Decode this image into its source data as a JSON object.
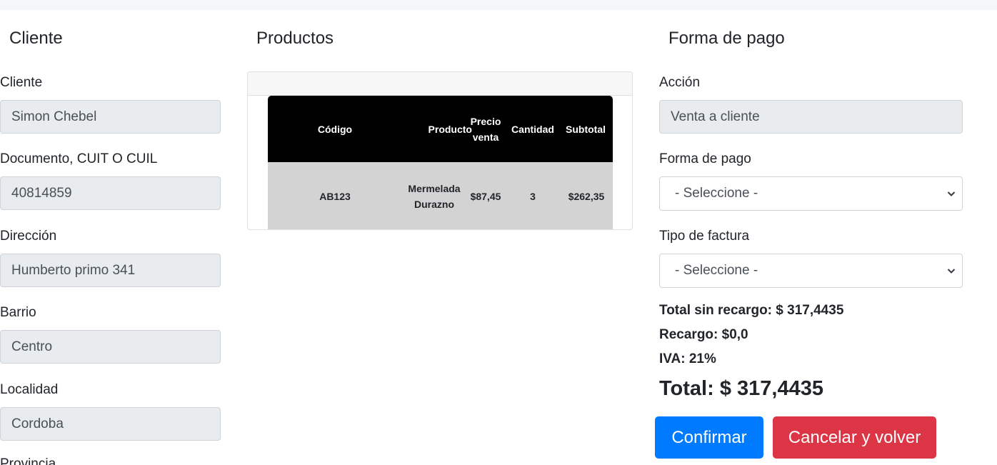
{
  "cliente": {
    "title": "Cliente",
    "fields": [
      {
        "label": "Cliente",
        "value": "Simon Chebel"
      },
      {
        "label": "Documento, CUIT O CUIL",
        "value": "40814859"
      },
      {
        "label": "Dirección",
        "value": "Humberto primo 341"
      },
      {
        "label": "Barrio",
        "value": "Centro"
      },
      {
        "label": "Localidad",
        "value": "Cordoba"
      }
    ],
    "partial_label": "Provincia"
  },
  "productos": {
    "title": "Productos",
    "columns": [
      "Código",
      "Producto",
      "Precio venta",
      "Cantidad",
      "Subtotal"
    ],
    "rows": [
      {
        "codigo": "AB123",
        "producto": "Mermelada Durazno",
        "precio": "$87,45",
        "cantidad": "3",
        "subtotal": "$262,35"
      }
    ]
  },
  "pago": {
    "title": "Forma de pago",
    "accion_label": "Acción",
    "accion_value": "Venta a cliente",
    "forma_label": "Forma de pago",
    "forma_value": "- Seleccione -",
    "factura_label": "Tipo de factura",
    "factura_value": "- Seleccione -",
    "total_sin_recargo": "Total sin recargo: $ 317,4435",
    "recargo": "Recargo: $0,0",
    "iva": "IVA: 21%",
    "total": "Total: $ 317,4435",
    "confirm_label": "Confirmar",
    "cancel_label": "Cancelar y volver"
  },
  "colors": {
    "primary": "#007bff",
    "danger": "#dc3545",
    "readonly_bg": "#e9ecef",
    "table_header": "#000000",
    "table_row": "#d3d3d3"
  },
  "icons": {
    "select_arrow": "chevron-down-icon"
  }
}
